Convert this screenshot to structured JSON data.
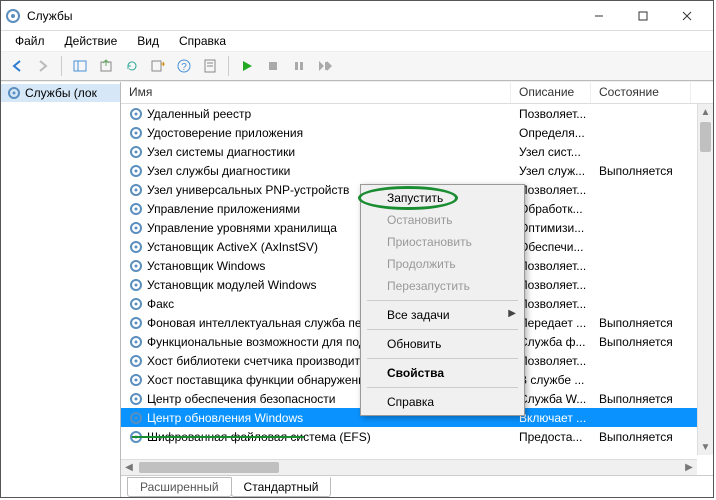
{
  "titlebar": {
    "title": "Службы"
  },
  "menubar": {
    "items": [
      "Файл",
      "Действие",
      "Вид",
      "Справка"
    ]
  },
  "tree": {
    "root_label": "Службы (лок"
  },
  "columns": {
    "name": "Имя",
    "desc": "Описание",
    "state": "Состояние"
  },
  "services": [
    {
      "name": "Удаленный реестр",
      "desc": "Позволяет...",
      "state": ""
    },
    {
      "name": "Удостоверение приложения",
      "desc": "Определя...",
      "state": ""
    },
    {
      "name": "Узел системы диагностики",
      "desc": "Узел сист...",
      "state": ""
    },
    {
      "name": "Узел службы диагностики",
      "desc": "Узел служ...",
      "state": "Выполняется"
    },
    {
      "name": "Узел универсальных PNP-устройств",
      "desc": "Позволяет...",
      "state": ""
    },
    {
      "name": "Управление приложениями",
      "desc": "Обработк...",
      "state": ""
    },
    {
      "name": "Управление уровнями хранилища",
      "desc": "Оптимизи...",
      "state": ""
    },
    {
      "name": "Установщик ActiveX (AxInstSV)",
      "desc": "Обеспечи...",
      "state": ""
    },
    {
      "name": "Установщик Windows",
      "desc": "Позволяет...",
      "state": ""
    },
    {
      "name": "Установщик модулей Windows",
      "desc": "Позволяет...",
      "state": ""
    },
    {
      "name": "Факс",
      "desc": "Позволяет...",
      "state": ""
    },
    {
      "name": "Фоновая интеллектуальная служба пере",
      "desc": "Передает ...",
      "state": "Выполняется"
    },
    {
      "name": "Функциональные возможности для подк",
      "desc": "Служба ф...",
      "state": "Выполняется"
    },
    {
      "name": "Хост библиотеки счетчика производите",
      "desc": "Позволяет...",
      "state": ""
    },
    {
      "name": "Хост поставщика функции обнаружения",
      "desc": "В службе ...",
      "state": ""
    },
    {
      "name": "Центр обеспечения безопасности",
      "desc": "Служба W...",
      "state": "Выполняется"
    },
    {
      "name": "Центр обновления Windows",
      "desc": "Включает ...",
      "state": "",
      "selected": true
    },
    {
      "name": "Шифрованная файловая система (EFS)",
      "desc": "Предоста...",
      "state": "Выполняется"
    }
  ],
  "context_menu": {
    "items": [
      {
        "label": "Запустить",
        "enabled": true
      },
      {
        "label": "Остановить",
        "enabled": false
      },
      {
        "label": "Приостановить",
        "enabled": false
      },
      {
        "label": "Продолжить",
        "enabled": false
      },
      {
        "label": "Перезапустить",
        "enabled": false
      },
      {
        "sep": true
      },
      {
        "label": "Все задачи",
        "enabled": true,
        "submenu": true
      },
      {
        "sep": true
      },
      {
        "label": "Обновить",
        "enabled": true
      },
      {
        "sep": true
      },
      {
        "label": "Свойства",
        "enabled": true,
        "bold": true
      },
      {
        "sep": true
      },
      {
        "label": "Справка",
        "enabled": true
      }
    ]
  },
  "tabs": {
    "extended": "Расширенный",
    "standard": "Стандартный"
  }
}
